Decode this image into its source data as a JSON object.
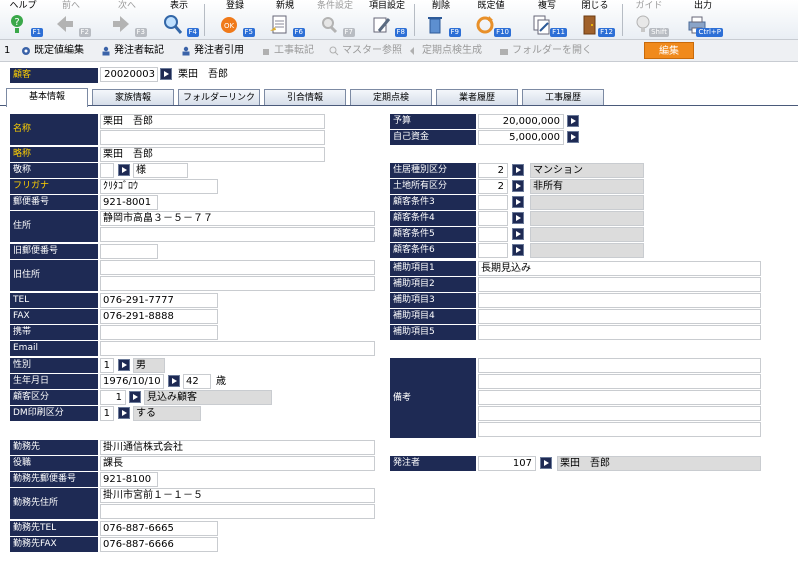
{
  "toolbar": {
    "help": {
      "label": "ヘルプ",
      "key": "F1"
    },
    "prev": {
      "label": "前へ",
      "key": "F2"
    },
    "next": {
      "label": "次へ",
      "key": "F3"
    },
    "show": {
      "label": "表示",
      "key": "F4"
    },
    "register": {
      "label": "登録",
      "key": "F5"
    },
    "new": {
      "label": "新規",
      "key": "F6"
    },
    "cond": {
      "label": "条件設定",
      "key": "F7"
    },
    "item": {
      "label": "項目設定",
      "key": "F8"
    },
    "delete": {
      "label": "削除",
      "key": "F9"
    },
    "default": {
      "label": "既定値",
      "key": "F10"
    },
    "copy": {
      "label": "複写",
      "key": "F11"
    },
    "close": {
      "label": "閉じる",
      "key": "F12"
    },
    "guide": {
      "label": "ガイド",
      "key": "Shift"
    },
    "output": {
      "label": "出力",
      "key": "Ctrl+P"
    }
  },
  "subbar": {
    "num": "1",
    "default_edit": "既定値編集",
    "order_copy": "発注者転記",
    "order_ref": "発注者引用",
    "work_copy": "工事転記",
    "master_ref": "マスター参照",
    "periodic": "定期点検生成",
    "folder": "フォルダーを開く",
    "edit_badge": "編集"
  },
  "customer": {
    "label": "顧客",
    "code": "20020003",
    "name": "栗田　吾郎"
  },
  "tabs": [
    "基本情報",
    "家族情報",
    "フォルダーリンク",
    "引合情報",
    "定期点検",
    "業者履歴",
    "工事履歴"
  ],
  "left": {
    "name_label": "名称",
    "name_value": "栗田　吾郎",
    "short_label": "略称",
    "short_value": "栗田　吾郎",
    "honor_label": "敬称",
    "honor_value": "様",
    "kana_label": "フリガナ",
    "kana_value": "ｸﾘﾀｺﾞﾛｳ",
    "zip_label": "郵便番号",
    "zip_value": "921-8001",
    "addr_label": "住所",
    "addr_value": "静岡市高畠３－５－７７",
    "oldzip_label": "旧郵便番号",
    "oldaddr_label": "旧住所",
    "tel_label": "TEL",
    "tel_value": "076-291-7777",
    "fax_label": "FAX",
    "fax_value": "076-291-8888",
    "mobile_label": "携帯",
    "email_label": "Email",
    "sex_label": "性別",
    "sex_code": "1",
    "sex_value": "男",
    "birth_label": "生年月日",
    "birth_value": "1976/10/10",
    "age_value": "42",
    "age_unit": "歳",
    "cust_type_label": "顧客区分",
    "cust_type_code": "1",
    "cust_type_value": "見込み顧客",
    "dm_label": "DM印刷区分",
    "dm_code": "1",
    "dm_value": "する",
    "work_label": "勤務先",
    "work_value": "掛川通信株式会社",
    "post_label": "役職",
    "post_value": "課長",
    "wzip_label": "勤務先郵便番号",
    "wzip_value": "921-8100",
    "waddr_label": "勤務先住所",
    "waddr_value": "掛川市宮前１－１－５",
    "wtel_label": "勤務先TEL",
    "wtel_value": "076-887-6665",
    "wfax_label": "勤務先FAX",
    "wfax_value": "076-887-6666"
  },
  "right": {
    "budget_label": "予算",
    "budget_value": "20,000,000",
    "own_label": "自己資金",
    "own_value": "5,000,000",
    "house_label": "住居種別区分",
    "house_code": "2",
    "house_value": "マンション",
    "land_label": "土地所有区分",
    "land_code": "2",
    "land_value": "非所有",
    "c3_label": "顧客条件3",
    "c4_label": "顧客条件4",
    "c5_label": "顧客条件5",
    "c6_label": "顧客条件6",
    "a1_label": "補助項目1",
    "a1_value": "長期見込み",
    "a2_label": "補助項目2",
    "a3_label": "補助項目3",
    "a4_label": "補助項目4",
    "a5_label": "補助項目5",
    "memo_label": "備考",
    "orderer_label": "発注者",
    "orderer_code": "107",
    "orderer_name": "栗田　吾郎"
  },
  "colors": {
    "label_bg": "#1e2a54",
    "label_highlight": "#ffd000",
    "badge": "#f08a1c",
    "fkey": "#2d6fd6"
  }
}
